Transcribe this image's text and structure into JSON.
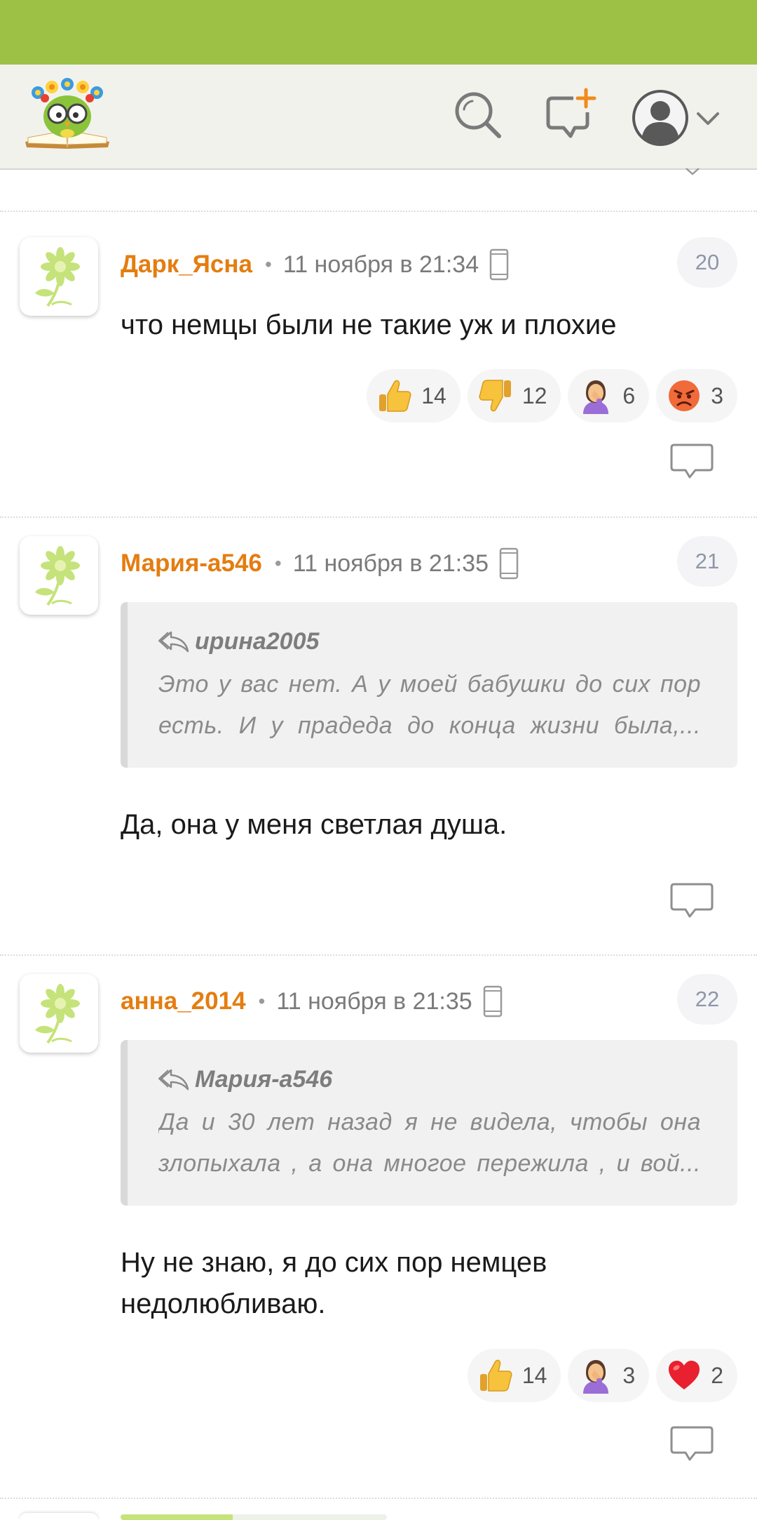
{
  "header": {
    "logo": "owl-reading-book-logo",
    "icons": [
      "search-icon",
      "new-post-icon",
      "user-avatar-icon",
      "chevron-down-icon"
    ]
  },
  "comments": [
    {
      "author": "Дарк_Ясна",
      "date": "11 ноября в 21:34",
      "number": "20",
      "text": "что немцы были не такие уж и плохие",
      "reactions": [
        {
          "emoji": "thumbs-up",
          "count": "14"
        },
        {
          "emoji": "thumbs-down",
          "count": "12"
        },
        {
          "emoji": "facepalm",
          "count": "6"
        },
        {
          "emoji": "angry-face",
          "count": "3"
        }
      ]
    },
    {
      "author": "Мария-а546",
      "date": "11 ноября в 21:35",
      "number": "21",
      "quote": {
        "author": "ирина2005",
        "line1": "Это у вас нет. А у моей бабушки до сих пор",
        "line2": "есть. И у прадеда до конца жизни была,..."
      },
      "text": "Да, она у меня светлая душа."
    },
    {
      "author": "анна_2014",
      "date": "11 ноября в 21:35",
      "number": "22",
      "quote": {
        "author": "Мария-а546",
        "line1": "Да и 30 лет назад я не видела, чтобы она",
        "line2": "злопыхала , а она многое пережила , и вой..."
      },
      "text": "Ну не знаю, я до сих пор немцев недолюбливаю.",
      "reactions": [
        {
          "emoji": "thumbs-up",
          "count": "14"
        },
        {
          "emoji": "facepalm",
          "count": "3"
        },
        {
          "emoji": "red-heart",
          "count": "2"
        }
      ]
    }
  ],
  "colors": {
    "status_bar": "#9dc144",
    "header_bg": "#f2f2ed",
    "author": "#e47d10",
    "new_post_plus": "#f08a1c"
  }
}
